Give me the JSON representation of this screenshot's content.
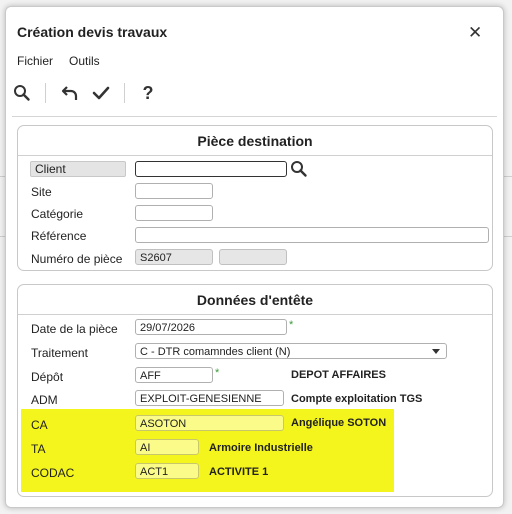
{
  "dialog": {
    "title": "Création devis travaux"
  },
  "menu": {
    "file": "Fichier",
    "tools": "Outils"
  },
  "toolbar": {
    "search_icon": "search-icon",
    "undo_icon": "undo-icon",
    "validate_icon": "check-icon",
    "help_icon": "help-icon",
    "help_glyph": "?"
  },
  "piece_destination": {
    "title": "Pièce destination",
    "client_label": "Client",
    "client_value": "",
    "site_label": "Site",
    "site_value": "",
    "categorie_label": "Catégorie",
    "categorie_value": "",
    "reference_label": "Référence",
    "reference_value": "",
    "numero_label": "Numéro de pièce",
    "numero_value": "S2607",
    "numero_value2": ""
  },
  "donnees_entete": {
    "title": "Données d'entête",
    "date_label": "Date de la pièce",
    "date_value": "29/07/2026",
    "traitement_label": "Traitement",
    "traitement_value": "C  - DTR comamndes client (N)",
    "depot_label": "Dépôt",
    "depot_value": "AFF",
    "depot_desc": "DEPOT AFFAIRES",
    "adm_label": "ADM",
    "adm_value": "EXPLOIT-GENESIENNE",
    "adm_desc": "Compte exploitation TGS",
    "ca_label": "CA",
    "ca_value": "ASOTON",
    "ca_desc": "Angélique SOTON",
    "ta_label": "TA",
    "ta_value": "AI",
    "ta_desc": "Armoire Industrielle",
    "codac_label": "CODAC",
    "codac_value": "ACT1",
    "codac_desc": "ACTIVITE 1",
    "required_mark": "*"
  },
  "colors": {
    "highlight": "#f5f51e",
    "accent": "#3a9a3a"
  }
}
